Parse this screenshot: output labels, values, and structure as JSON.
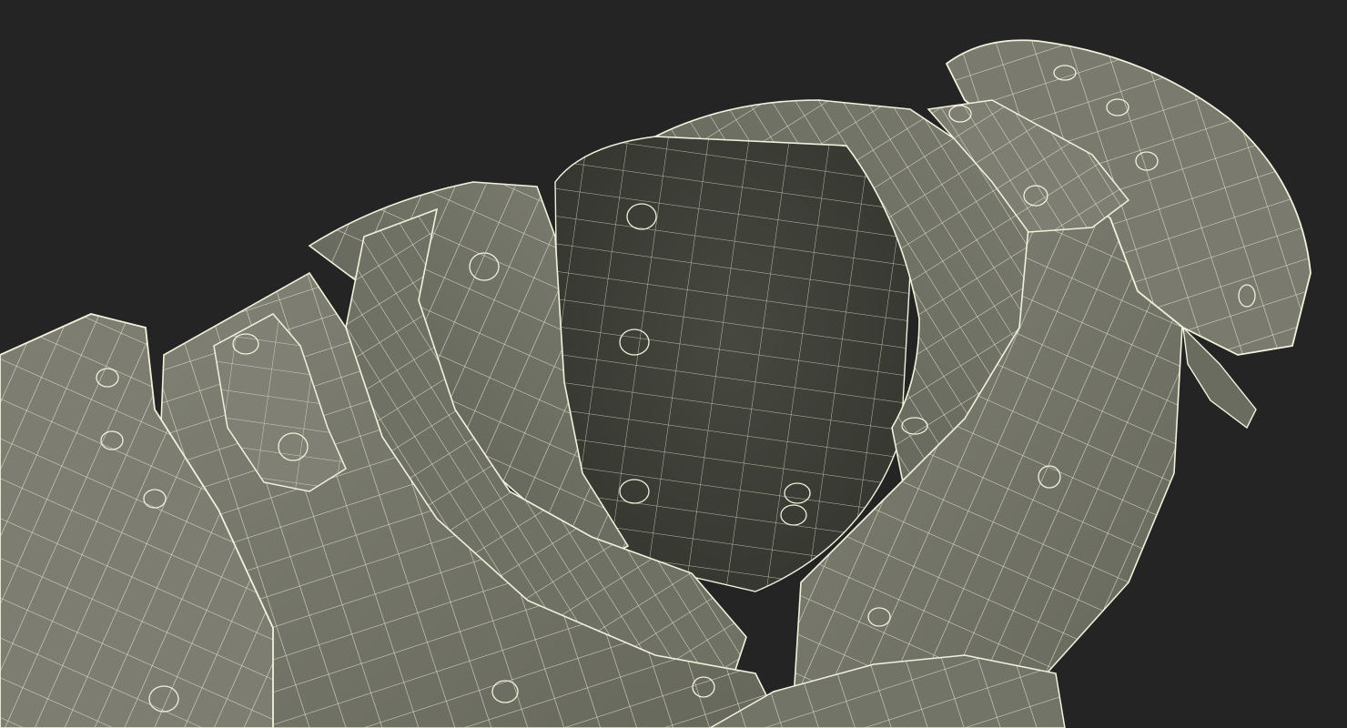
{
  "scene": {
    "background_color": "#242424",
    "subject": "wireframe-3d-armor-vest",
    "colors": {
      "panel_light": "#7b7c6f",
      "panel_mid": "#6a6b5f",
      "panel_dark": "#4f5048",
      "interior": "#44463f",
      "interior_deep": "#393a34",
      "wire": "#f2f1dc",
      "shadow": "#1c1c1a"
    }
  }
}
